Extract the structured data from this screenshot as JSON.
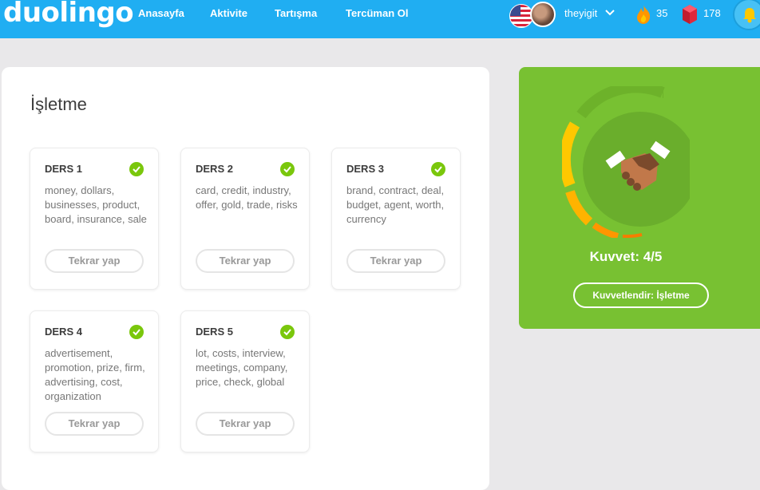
{
  "header": {
    "logo": "duolingo",
    "nav": [
      "Anasayfa",
      "Aktivite",
      "Tartışma",
      "Tercüman Ol"
    ],
    "username": "theyigit",
    "streak": "35",
    "gems": "178"
  },
  "skill": {
    "title": "İşletme",
    "lessons": [
      {
        "label": "DERS 1",
        "words": "money, dollars, businesses, product, board, insurance, sale",
        "button": "Tekrar yap"
      },
      {
        "label": "DERS 2",
        "words": "card, credit, industry, offer, gold, trade, risks",
        "button": "Tekrar yap"
      },
      {
        "label": "DERS 3",
        "words": "brand, contract, deal, budget, agent, worth, currency",
        "button": "Tekrar yap"
      },
      {
        "label": "DERS 4",
        "words": "advertisement, promotion, prize, firm, advertising, cost, organization",
        "button": "Tekrar yap"
      },
      {
        "label": "DERS 5",
        "words": "lot, costs, interview, meetings, company, price, check, global",
        "button": "Tekrar yap"
      }
    ]
  },
  "strength_panel": {
    "label": "Kuvvet: 4/5",
    "strength_level": 4,
    "strength_max": 5,
    "button": "Kuvvetlendir: İşletme",
    "colors": {
      "bg": "#78c132",
      "gold": "#ffc800",
      "orange": "#ff9600"
    }
  }
}
